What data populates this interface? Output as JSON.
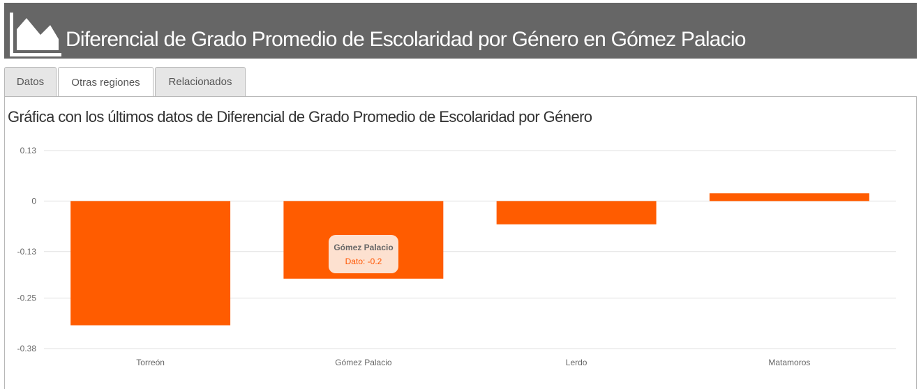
{
  "header": {
    "title": "Diferencial de Grado Promedio de Escolaridad por Género en Gómez Palacio",
    "icon": "area-chart-icon"
  },
  "tabs": [
    {
      "label": "Datos",
      "active": false
    },
    {
      "label": "Otras regiones",
      "active": true
    },
    {
      "label": "Relacionados",
      "active": false
    }
  ],
  "chart_heading": "Gráfica con los últimos datos de Diferencial de Grado Promedio de Escolaridad por Género",
  "chart_data": {
    "type": "bar",
    "categories": [
      "Torreón",
      "Gómez Palacio",
      "Lerdo",
      "Matamoros"
    ],
    "values": [
      -0.32,
      -0.2,
      -0.06,
      0.02
    ],
    "yticks": [
      "0.13",
      "0",
      "-0.13",
      "-0.25",
      "-0.38"
    ],
    "ylim": [
      -0.38,
      0.13
    ],
    "grid": true,
    "bar_color": "#ff5c00",
    "grid_color": "#e0e0e0"
  },
  "tooltip": {
    "category": "Gómez Palacio",
    "text": "Dato: -0.2"
  }
}
